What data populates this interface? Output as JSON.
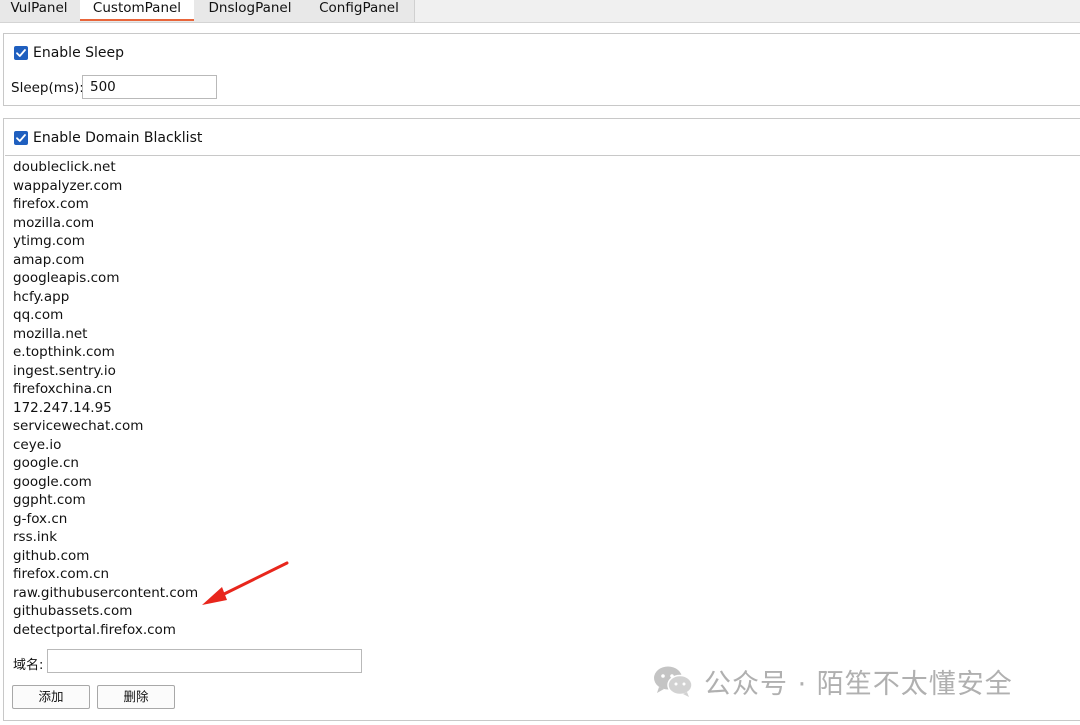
{
  "tabs": [
    {
      "label": "VulPanel",
      "active": false
    },
    {
      "label": "CustomPanel",
      "active": true
    },
    {
      "label": "DnslogPanel",
      "active": false
    },
    {
      "label": "ConfigPanel",
      "active": false
    }
  ],
  "sleep": {
    "enable_label": "Enable Sleep",
    "enabled": true,
    "ms_label": "Sleep(ms):",
    "ms_value": "500"
  },
  "blacklist": {
    "enable_label": "Enable Domain Blacklist",
    "enabled": true,
    "domains": [
      "doubleclick.net",
      "wappalyzer.com",
      "firefox.com",
      "mozilla.com",
      "ytimg.com",
      "amap.com",
      "googleapis.com",
      "hcfy.app",
      "qq.com",
      "mozilla.net",
      "e.topthink.com",
      "ingest.sentry.io",
      "firefoxchina.cn",
      "172.247.14.95",
      "servicewechat.com",
      "ceye.io",
      "google.cn",
      "google.com",
      "ggpht.com",
      "g-fox.cn",
      "rss.ink",
      "github.com",
      "firefox.com.cn",
      "raw.githubusercontent.com",
      "githubassets.com",
      "detectportal.firefox.com"
    ]
  },
  "domain_form": {
    "label": "域名:",
    "value": "",
    "add_label": "添加",
    "delete_label": "删除"
  },
  "watermark": {
    "text": "公众号 · 陌笙不太懂安全"
  },
  "colors": {
    "checkbox": "#1f5fbf",
    "active_tab_underline": "#e8653a",
    "annotation_arrow": "#e8261c",
    "watermark": "#b0b0b0"
  }
}
